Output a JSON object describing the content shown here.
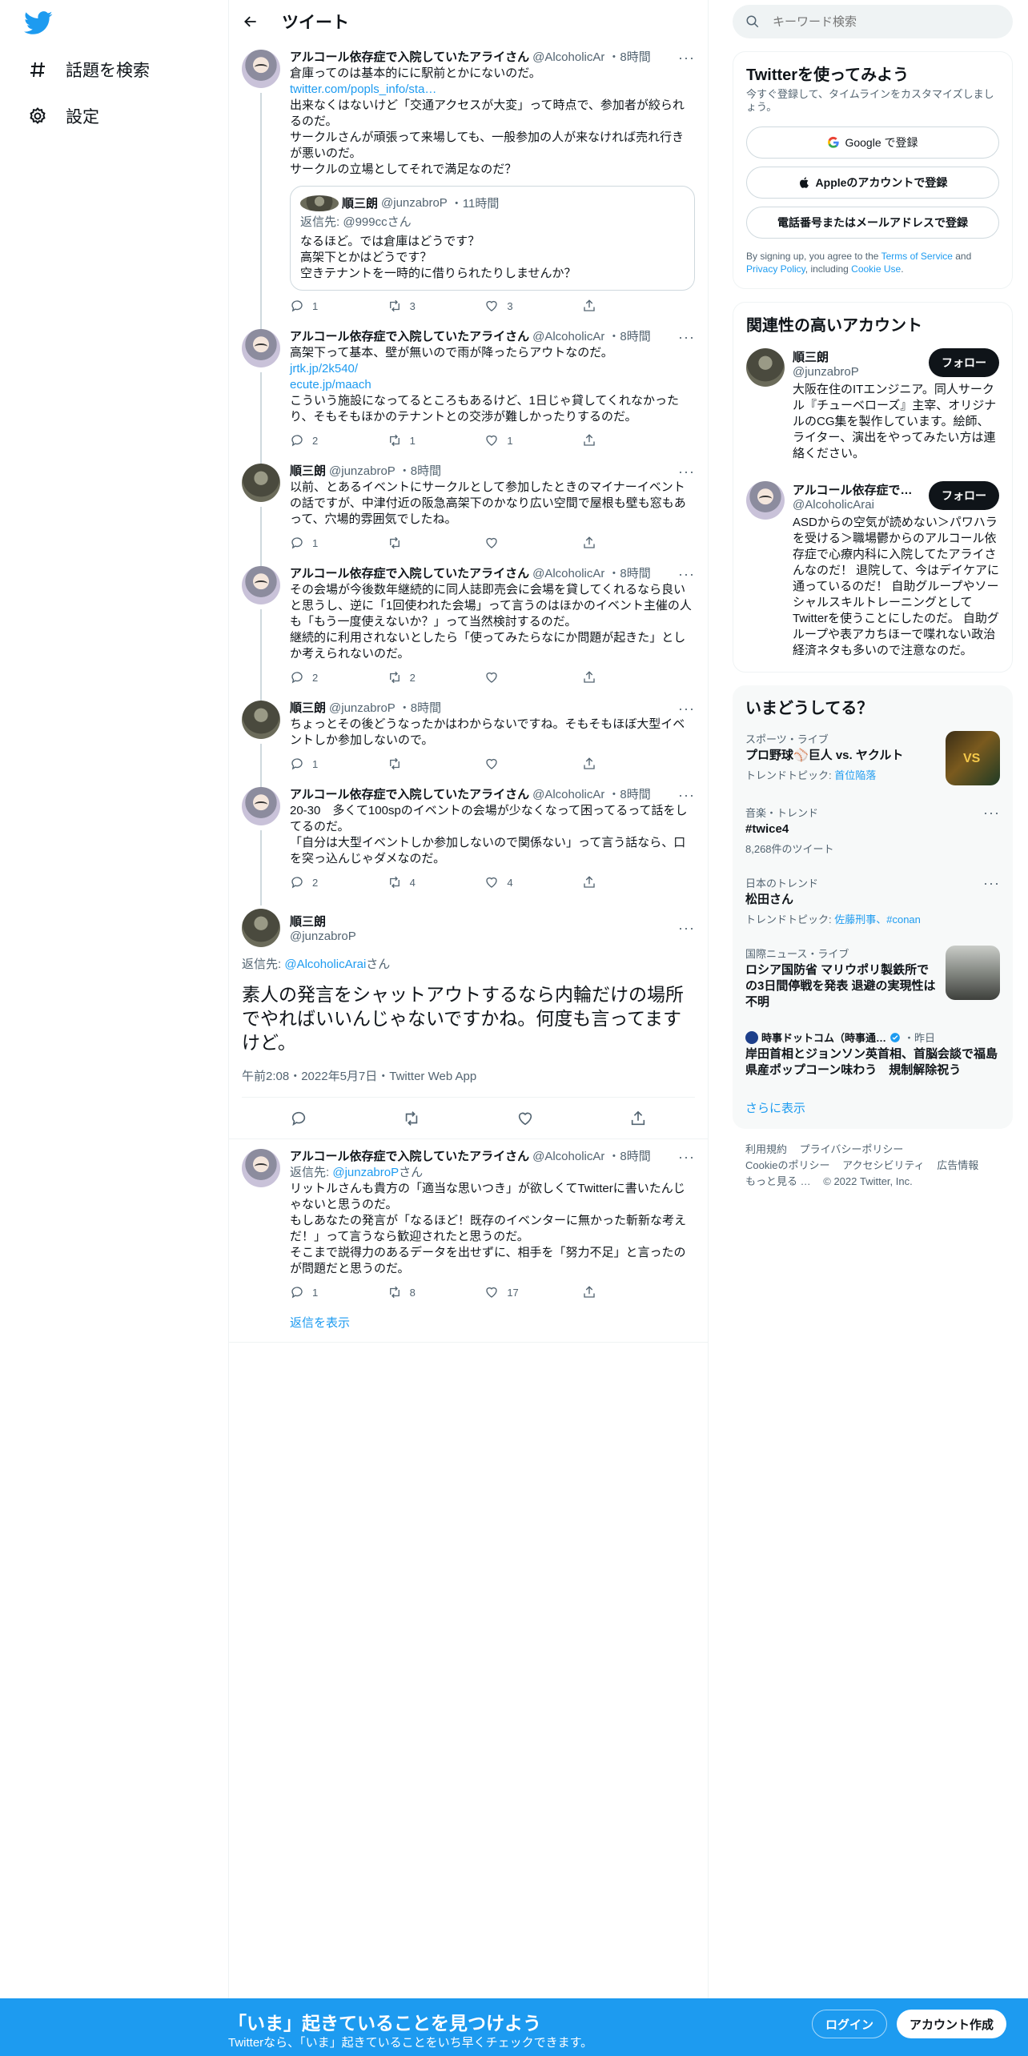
{
  "nav": {
    "explore_label": "話題を検索",
    "settings_label": "設定"
  },
  "header": {
    "title": "ツイート"
  },
  "tweets": [
    {
      "name": "アルコール依存症で入院していたアライさん",
      "handle": "@AlcoholicAr",
      "time": "・8時間",
      "lines": [
        "倉庫ってのは基本的にに駅前とかにないのだ。"
      ],
      "link": "twitter.com/popls_info/sta…",
      "lines2": "出来なくはないけど「交通アクセスが大変」って時点で、参加者が絞られるのだ。\nサークルさんが頑張って来場しても、一般参加の人が来なければ売れ行きが悪いのだ。\nサークルの立場としてそれで満足なのだ？",
      "quote": {
        "name": "順三朗",
        "handle": "@junzabroP",
        "time": "・11時間",
        "replyto_prefix": "返信先: ",
        "replyto_user": "@999ccさん",
        "text": "なるほど。では倉庫はどうです？\n高架下とかはどうです？\n空きテナントを一時的に借りられたりしませんか？"
      },
      "replies": "1",
      "retweets": "3",
      "likes": "3"
    },
    {
      "name": "アルコール依存症で入院していたアライさん",
      "handle": "@AlcoholicAr",
      "time": "・8時間",
      "text1": "高架下って基本、壁が無いので雨が降ったらアウトなのだ。",
      "link1": "jrtk.jp/2k540/",
      "link2": "ecute.jp/maach",
      "text2": "こういう施設になってるところもあるけど、1日じゃ貸してくれなかったり、そもそもほかのテナントとの交渉が難しかったりするのだ。",
      "replies": "2",
      "retweets": "1",
      "likes": "1"
    },
    {
      "name": "順三朗",
      "handle": "@junzabroP",
      "time": "・8時間",
      "text": "以前、とあるイベントにサークルとして参加したときのマイナーイベントの話ですが、中津付近の阪急高架下のかなり広い空間で屋根も壁も窓もあって、穴場的雰囲気でしたね。",
      "replies": "1",
      "retweets": "",
      "likes": ""
    },
    {
      "name": "アルコール依存症で入院していたアライさん",
      "handle": "@AlcoholicAr",
      "time": "・8時間",
      "text": "その会場が今後数年継続的に同人誌即売会に会場を貸してくれるなら良いと思うし、逆に「1回使われた会場」って言うのはほかのイベント主催の人も「もう一度使えないか？」って当然検討するのだ。\n継続的に利用されないとしたら「使ってみたらなにか問題が起きた」としか考えられないのだ。",
      "replies": "2",
      "retweets": "2",
      "likes": ""
    },
    {
      "name": "順三朗",
      "handle": "@junzabroP",
      "time": "・8時間",
      "text": "ちょっとその後どうなったかはわからないですね。そもそもほぼ大型イベントしか参加しないので。",
      "replies": "1",
      "retweets": "",
      "likes": ""
    },
    {
      "name": "アルコール依存症で入院していたアライさん",
      "handle": "@AlcoholicAr",
      "time": "・8時間",
      "text": "20-30　多くて100spのイベントの会場が少なくなって困ってるって話をしてるのだ。\n「自分は大型イベントしか参加しないので関係ない」って言う話なら、口を突っ込んじゃダメなのだ。",
      "replies": "2",
      "retweets": "4",
      "likes": "4"
    }
  ],
  "focus": {
    "name": "順三朗",
    "handle": "@junzabroP",
    "replyto_prefix": "返信先: ",
    "replyto_user": "@AlcoholicArai",
    "replyto_suffix": "さん",
    "text": "素人の発言をシャットアウトするなら内輪だけの場所でやればいいんじゃないですかね。何度も言ってますけど。",
    "meta": "午前2:08・2022年5月7日・Twitter Web App"
  },
  "reply": {
    "name": "アルコール依存症で入院していたアライさん",
    "handle": "@AlcoholicAr",
    "time": "・8時間",
    "replyto_prefix": "返信先: ",
    "replyto_user": "@junzabroP",
    "replyto_suffix": "さん",
    "text": "リットルさんも貴方の「適当な思いつき」が欲しくてTwitterに書いたんじゃないと思うのだ。\nもしあなたの発言が「なるほど！既存のイベンターに無かった斬新な考えだ！」って言うなら歓迎されたと思うのだ。\nそこまで説得力のあるデータを出せずに、相手を「努力不足」と言ったのが問題だと思うのだ。",
    "replies": "1",
    "retweets": "8",
    "likes": "17",
    "show_replies": "返信を表示"
  },
  "right": {
    "search_placeholder": "キーワード検索",
    "signup": {
      "title": "Twitterを使ってみよう",
      "sub": "今すぐ登録して、タイムラインをカスタマイズしましょう。",
      "google": "Google で登録",
      "apple": "Appleのアカウントで登録",
      "phone": "電話番号またはメールアドレスで登録",
      "terms_a": "By signing up, you agree to the ",
      "terms_tos": "Terms of Service",
      "terms_b": " and ",
      "terms_privacy": "Privacy Policy",
      "terms_c": ", including ",
      "terms_cookie": "Cookie Use",
      "terms_d": "."
    },
    "related": {
      "title": "関連性の高いアカウント",
      "follow_label": "フォロー",
      "accounts": [
        {
          "name": "順三朗",
          "handle": "@junzabroP",
          "bio": "大阪在住のITエンジニア。同人サークル『チューベローズ』主宰、オリジナルのCG集を製作しています。絵師、ライター、演出をやってみたい方は連絡ください。"
        },
        {
          "name": "アルコール依存症で…",
          "handle": "@AlcoholicArai",
          "bio": "ASDからの空気が読めない＞パワハラを受ける＞職場鬱からのアルコール依存症で心療内科に入院してたアライさんなのだ！ 退院して、今はデイケアに通っているのだ！ 自助グループやソーシャルスキルトレーニングとしてTwitterを使うことにしたのだ。 自助グループや表アカちほーで喋れない政治経済ネタも多いので注意なのだ。"
        }
      ]
    },
    "trends": {
      "title": "いまどうしてる？",
      "items": [
        {
          "cat": "スポーツ・ライブ",
          "name": "プロ野球⚾巨人 vs. ヤクルト",
          "sub_prefix": "トレンドトピック: ",
          "sub_link": "首位陥落"
        },
        {
          "cat": "音楽・トレンド",
          "name": "#twice4",
          "sub": "8,268件のツイート"
        },
        {
          "cat": "日本のトレンド",
          "name": "松田さん",
          "sub_prefix": "トレンドトピック: ",
          "sub_link": "佐藤刑事、#conan"
        },
        {
          "cat": "国際ニュース・ライブ",
          "name": "ロシア国防省 マリウポリ製鉄所での3日間停戦を発表 退避の実現性は不明"
        },
        {
          "cat_prefix": "時事ドットコム（時事通…",
          "cat_suffix": "・昨日",
          "name": "岸田首相とジョンソン英首相、首脳会談で福島県産ポップコーン味わう　規制解除祝う"
        }
      ],
      "show_more": "さらに表示"
    },
    "footer": {
      "links": [
        "利用規約",
        "プライバシーポリシー",
        "Cookieのポリシー",
        "アクセシビリティ",
        "広告情報",
        "もっと見る …",
        "© 2022 Twitter, Inc."
      ]
    }
  },
  "bottombar": {
    "title": "「いま」起きていることを見つけよう",
    "sub": "Twitterなら、「いま」起きていることをいち早くチェックできます。",
    "login": "ログイン",
    "signup": "アカウント作成"
  },
  "colors": {
    "accent": "#1d9bf0",
    "text": "#0f1419",
    "secondary": "#536471"
  }
}
